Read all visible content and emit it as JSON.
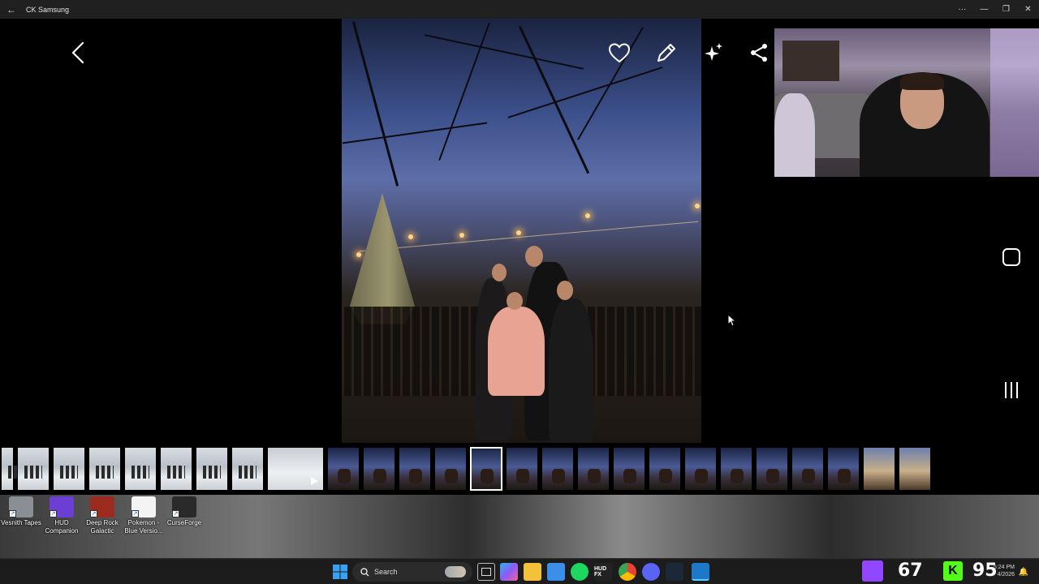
{
  "window": {
    "title": "CK Samsung",
    "back_glyph": "←",
    "more_glyph": "···",
    "min_glyph": "—",
    "restore_glyph": "❐",
    "close_glyph": "✕"
  },
  "viewer": {
    "icons": [
      "back-chevron-icon",
      "heart-icon",
      "pencil-icon",
      "sparkle-icon",
      "share-icon",
      "home-square-icon",
      "recents-icon"
    ]
  },
  "thumbnails": [
    {
      "kind": "snow"
    },
    {
      "kind": "snow"
    },
    {
      "kind": "snow"
    },
    {
      "kind": "snow"
    },
    {
      "kind": "snow"
    },
    {
      "kind": "snow"
    },
    {
      "kind": "snow"
    },
    {
      "kind": "snow"
    },
    {
      "kind": "video"
    },
    {
      "kind": "night"
    },
    {
      "kind": "night"
    },
    {
      "kind": "night"
    },
    {
      "kind": "night"
    },
    {
      "kind": "night",
      "selected": true
    },
    {
      "kind": "night"
    },
    {
      "kind": "night"
    },
    {
      "kind": "night"
    },
    {
      "kind": "night"
    },
    {
      "kind": "night"
    },
    {
      "kind": "night"
    },
    {
      "kind": "night"
    },
    {
      "kind": "night"
    },
    {
      "kind": "night"
    },
    {
      "kind": "night"
    },
    {
      "kind": "sunset"
    },
    {
      "kind": "sunset"
    }
  ],
  "desktop_icons": [
    {
      "label": "Vesnith Tapes",
      "color": "#8a8f96"
    },
    {
      "label": "HUD Companion",
      "color": "#6b3fd4"
    },
    {
      "label": "Deep Rock Galactic",
      "color": "#9b2a1f"
    },
    {
      "label": "Pokemon - Blue Versio...",
      "color": "#f4f4f4"
    },
    {
      "label": "CurseForge",
      "color": "#2a2a2a"
    }
  ],
  "taskbar": {
    "search_placeholder": "Search",
    "hud_label": "HUD FX",
    "tray_left_number": "67",
    "tray_right_number": "95",
    "time": "5:24 PM",
    "date": "4/2026"
  }
}
